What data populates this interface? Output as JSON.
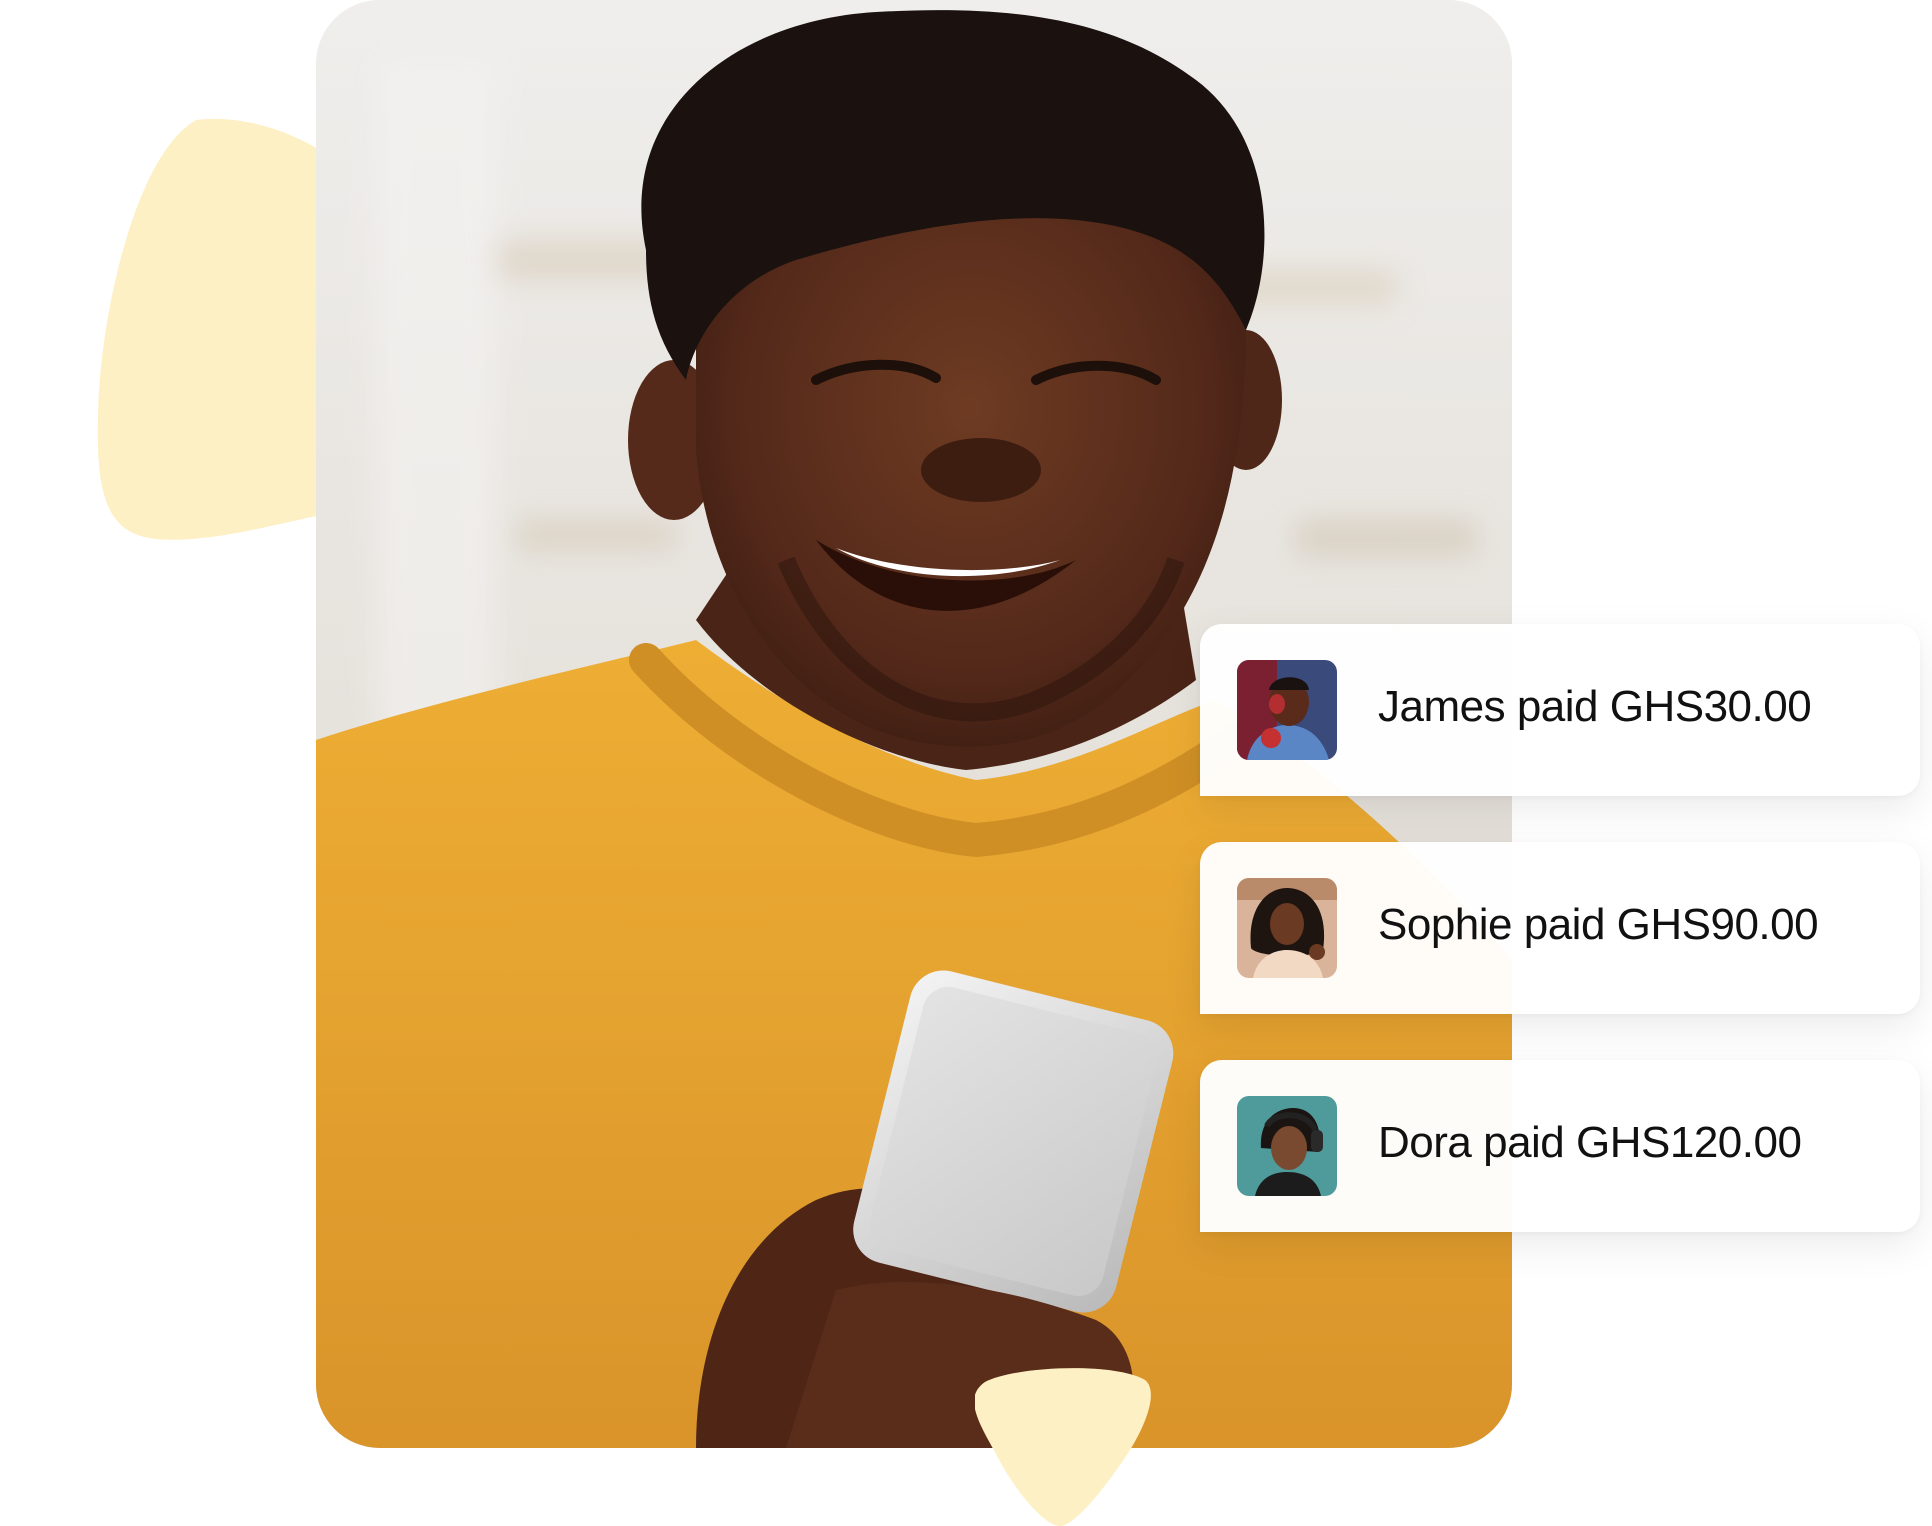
{
  "colors": {
    "blob": "#fdf0c4",
    "sweater": "#e7a52c",
    "skin": "#5a301c",
    "card_text": "#111111"
  },
  "hero_photo": {
    "icon": "smiling-man-with-phone-photo"
  },
  "notifications": [
    {
      "text": "James paid GHS30.00",
      "avatar_icon": "james-avatar-photo"
    },
    {
      "text": "Sophie paid GHS90.00",
      "avatar_icon": "sophie-avatar-photo"
    },
    {
      "text": "Dora paid GHS120.00",
      "avatar_icon": "dora-avatar-photo"
    }
  ]
}
